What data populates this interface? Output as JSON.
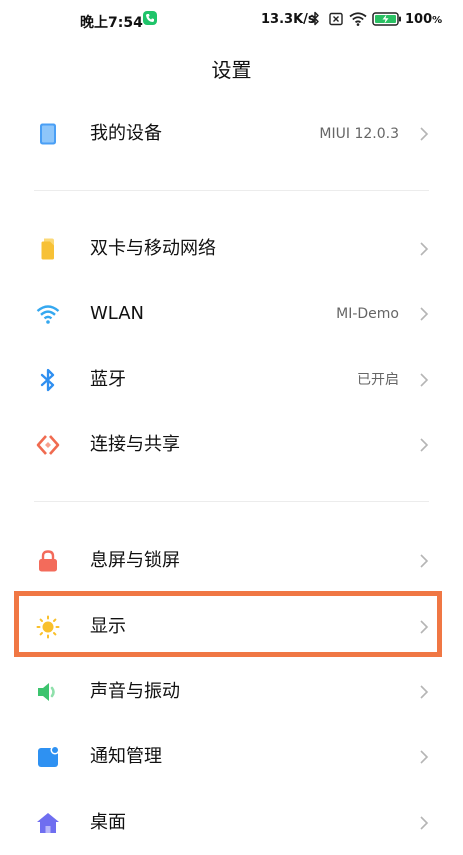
{
  "status_bar": {
    "time": "晚上7:54",
    "net_speed": "13.3K/s",
    "battery_percent": "100",
    "battery_unit": "%",
    "icons": [
      "phone-call-icon",
      "bluetooth-icon",
      "no-sim-icon",
      "wifi-icon",
      "battery-charging-icon"
    ]
  },
  "header": {
    "title": "设置"
  },
  "groups": [
    {
      "items": [
        {
          "label": "我的设备",
          "value": "MIUI 12.0.3",
          "icon": "device-icon",
          "color": "#4a9ff5"
        }
      ]
    },
    {
      "items": [
        {
          "label": "双卡与移动网络",
          "value": "",
          "icon": "sim-card-icon",
          "color": "#f7c136"
        },
        {
          "label": "WLAN",
          "value": "MI-Demo",
          "icon": "wifi-icon",
          "color": "#35a8f0"
        },
        {
          "label": "蓝牙",
          "value": "已开启",
          "icon": "bluetooth-icon",
          "color": "#2f8ff0"
        },
        {
          "label": "连接与共享",
          "value": "",
          "icon": "connection-share-icon",
          "color": "#f06b50"
        }
      ]
    },
    {
      "items": [
        {
          "label": "息屏与锁屏",
          "value": "",
          "icon": "lock-icon",
          "color": "#f36b5b"
        },
        {
          "label": "显示",
          "value": "",
          "icon": "sun-icon",
          "color": "#f9c02b"
        },
        {
          "label": "声音与振动",
          "value": "",
          "icon": "speaker-icon",
          "color": "#3cc46e"
        },
        {
          "label": "通知管理",
          "value": "",
          "icon": "notification-icon",
          "color": "#2e91f2"
        },
        {
          "label": "桌面",
          "value": "",
          "icon": "home-icon",
          "color": "#6f6ef0"
        }
      ]
    }
  ],
  "highlight_color": "#f07744"
}
